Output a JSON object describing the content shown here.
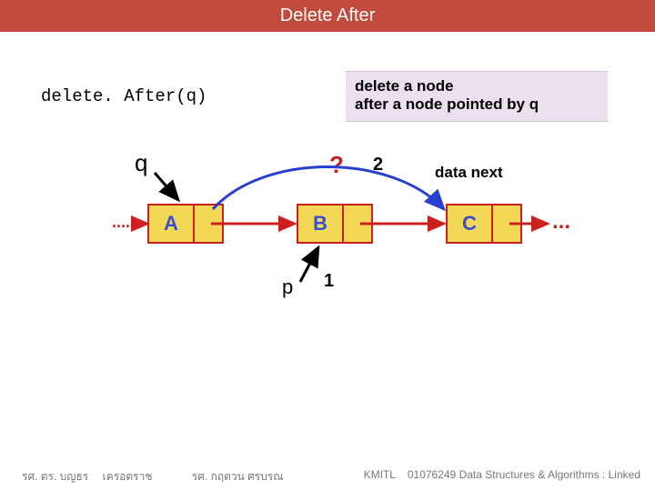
{
  "title": "Delete After",
  "function_label": "delete. After(q)",
  "description_line1": "delete a node",
  "description_line2": "after a node pointed by q",
  "labels": {
    "q": "q",
    "p": "p",
    "one": "1",
    "two": "2",
    "question": "?",
    "data_next": "data next"
  },
  "nodes": {
    "a": "A",
    "b": "B",
    "c": "C"
  },
  "dots": {
    "left": "....",
    "right": "..."
  },
  "footer": {
    "author1a": "รศ. ดร. บญธร",
    "author1b": "เครอตราช",
    "author2": "รศ. กฤตวน  ศรบรณ",
    "inst": "KMITL",
    "course": "01076249 Data Structures & Algorithms : Linked"
  },
  "colors": {
    "bar": "#c04a3e",
    "node_fill": "#f3d857",
    "node_border": "#cc2020"
  }
}
